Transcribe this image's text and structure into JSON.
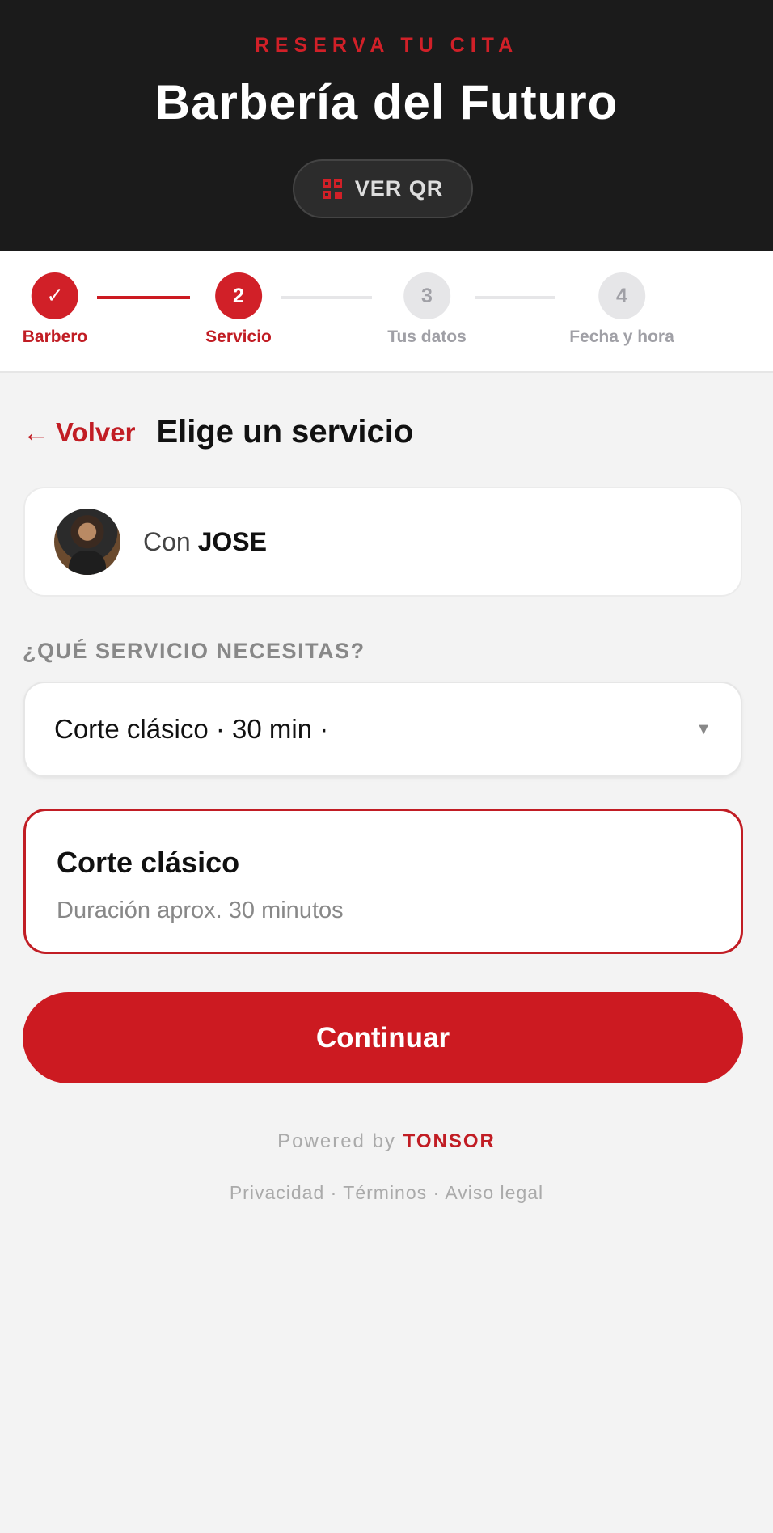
{
  "header": {
    "eyebrow": "RESERVA TU CITA",
    "shop_name": "Barbería del Futuro",
    "qr_button": "VER QR"
  },
  "stepper": {
    "steps": [
      {
        "number": "✓",
        "label": "Barbero",
        "state": "done"
      },
      {
        "number": "2",
        "label": "Servicio",
        "state": "active"
      },
      {
        "number": "3",
        "label": "Tus datos",
        "state": "todo"
      },
      {
        "number": "4",
        "label": "Fecha y hora",
        "state": "todo"
      }
    ]
  },
  "main": {
    "back_label": "Volver",
    "title": "Elige un servicio",
    "barber": {
      "prefix": "Con",
      "name": "JOSE"
    },
    "section_label": "¿QUÉ SERVICIO NECESITAS?",
    "service_select": {
      "value": "Corte clásico · 30 min ·"
    },
    "selected_service": {
      "name": "Corte clásico",
      "description": "Duración aprox. 30 minutos"
    },
    "continue_label": "Continuar"
  },
  "footer": {
    "powered_prefix": "Powered by",
    "brand": "TONSOR",
    "privacy": "Privacidad",
    "terms": "Términos",
    "legal_notice": "Aviso legal",
    "separator": "·"
  },
  "colors": {
    "accent": "#cc1a21",
    "header_bg": "#1b1b1b",
    "page_bg": "#f3f3f3",
    "inactive": "#a0a0a6"
  }
}
